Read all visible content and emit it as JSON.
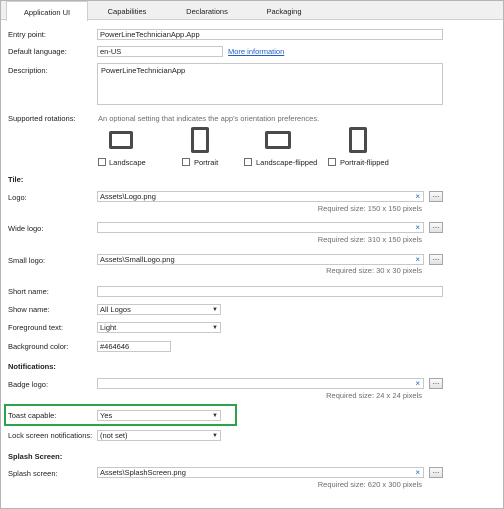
{
  "tabs": [
    "Application UI",
    "Capabilities",
    "Declarations",
    "Packaging"
  ],
  "app": {
    "entry_point_label": "Entry point:",
    "entry_point_value": "PowerLineTechnicianApp.App",
    "default_language_label": "Default language:",
    "default_language_value": "en-US",
    "more_information": "More information",
    "description_label": "Description:",
    "description_value": "PowerLineTechnicianApp"
  },
  "rotations": {
    "label": "Supported rotations:",
    "hint": "An optional setting that indicates the app's orientation preferences.",
    "options": [
      "Landscape",
      "Portrait",
      "Landscape-flipped",
      "Portrait-flipped"
    ]
  },
  "tile": {
    "section": "Tile:",
    "logo_label": "Logo:",
    "logo_value": "Assets\\Logo.png",
    "logo_required": "Required size: 150 x 150 pixels",
    "wide_logo_label": "Wide logo:",
    "wide_logo_value": "",
    "wide_logo_required": "Required size: 310 x 150 pixels",
    "small_logo_label": "Small logo:",
    "small_logo_value": "Assets\\SmallLogo.png",
    "small_logo_required": "Required size: 30 x 30 pixels",
    "short_name_label": "Short name:",
    "short_name_value": "",
    "show_name_label": "Show name:",
    "show_name_value": "All Logos",
    "foreground_text_label": "Foreground text:",
    "foreground_text_value": "Light",
    "background_color_label": "Background color:",
    "background_color_value": "#464646"
  },
  "notifications": {
    "section": "Notifications:",
    "badge_logo_label": "Badge logo:",
    "badge_logo_value": "",
    "badge_logo_required": "Required size: 24 x 24 pixels",
    "toast_capable_label": "Toast capable:",
    "toast_capable_value": "Yes",
    "lock_screen_label": "Lock screen notifications:",
    "lock_screen_value": "(not set)"
  },
  "splash": {
    "section": "Splash Screen:",
    "splash_label": "Splash screen:",
    "splash_value": "Assets\\SplashScreen.png",
    "splash_required": "Required size: 620 x 300 pixels"
  },
  "colors": {
    "highlight": "#2aa34a",
    "link": "#1f5fbf"
  },
  "icons": {
    "clear": "×",
    "browse": "...",
    "dropdown": "▼"
  }
}
